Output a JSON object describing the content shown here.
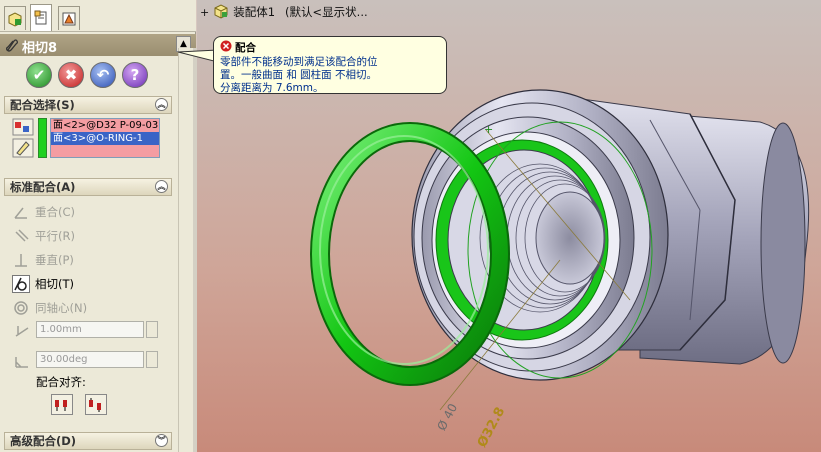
{
  "crumb": {
    "assembly": "装配体1",
    "config": "(默认<显示状..."
  },
  "panel": {
    "title": "相切8",
    "actions": {
      "ok": "✔",
      "cancel": "✖",
      "undo": "↶",
      "help": "?"
    }
  },
  "sections": {
    "selections": {
      "title": "配合选择(S)",
      "items": [
        "面<2>@D32 P-09-03(",
        "面<3>@O-RING-1",
        ""
      ]
    },
    "standard": {
      "title": "标准配合(A)"
    },
    "advanced": {
      "title": "高级配合(D)"
    }
  },
  "mates": {
    "coincident": "重合(C)",
    "parallel": "平行(R)",
    "perpendicular": "垂直(P)",
    "tangent": "相切(T)",
    "concentric": "同轴心(N)",
    "distance": "1.00mm",
    "angle": "30.00deg",
    "alignment": "配合对齐:"
  },
  "tooltip": {
    "title": "配合",
    "lines": [
      "零部件不能移动到满足该配合的位",
      "置。一般曲面 和 圆柱面 不相切。",
      "分离距离为 7.6mm。"
    ]
  },
  "dims": {
    "d1": "Ø 40",
    "d2": "Ø32.8"
  },
  "colors": {
    "ring": "#13c613",
    "selection_pink": "#f49da2",
    "selection_blue": "#3a64c6",
    "background_top": "#c9c0bc",
    "background_bottom": "#c88a7a"
  }
}
